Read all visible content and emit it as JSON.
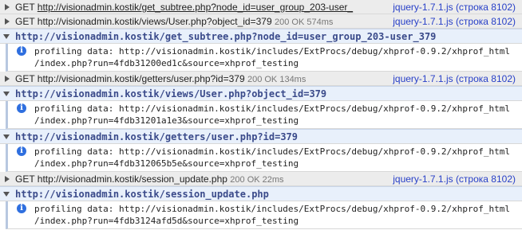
{
  "rows": [
    {
      "kind": "req",
      "method": "GET",
      "url": "http://visionadmin.kostik/get_subtree.php?node_id=user_group_203-user_",
      "status": "",
      "source": "jquery-1.7.1.js (строка 8102)"
    },
    {
      "kind": "req",
      "method": "GET",
      "url": "http://visionadmin.kostik/views/User.php?object_id=379",
      "status": "200 OK 574ms",
      "source": "jquery-1.7.1.js (строка 8102)"
    },
    {
      "kind": "grp",
      "url": "http://visionadmin.kostik/get_subtree.php?node_id=user_group_203-user_379"
    },
    {
      "kind": "msg",
      "line1": "profiling data: http://visionadmin.kostik/includes/ExtProcs/debug/xhprof-0.9.2/xhprof_html",
      "line2": "/index.php?run=4fdb31200ed1c&source=xhprof_testing"
    },
    {
      "kind": "req",
      "method": "GET",
      "url": "http://visionadmin.kostik/getters/user.php?id=379",
      "status": "200 OK 134ms",
      "source": "jquery-1.7.1.js (строка 8102)"
    },
    {
      "kind": "grp",
      "url": "http://visionadmin.kostik/views/User.php?object_id=379"
    },
    {
      "kind": "msg",
      "line1": "profiling data: http://visionadmin.kostik/includes/ExtProcs/debug/xhprof-0.9.2/xhprof_html",
      "line2": "/index.php?run=4fdb31201a1e3&source=xhprof_testing"
    },
    {
      "kind": "grp",
      "url": "http://visionadmin.kostik/getters/user.php?id=379"
    },
    {
      "kind": "msg",
      "line1": "profiling data: http://visionadmin.kostik/includes/ExtProcs/debug/xhprof-0.9.2/xhprof_html",
      "line2": "/index.php?run=4fdb312065b5e&source=xhprof_testing"
    },
    {
      "kind": "req",
      "method": "GET",
      "url": "http://visionadmin.kostik/session_update.php",
      "status": "200 OK 22ms",
      "source": "jquery-1.7.1.js (строка 8102)"
    },
    {
      "kind": "grp",
      "url": "http://visionadmin.kostik/session_update.php"
    },
    {
      "kind": "msg",
      "line1": "profiling data: http://visionadmin.kostik/includes/ExtProcs/debug/xhprof-0.9.2/xhprof_html",
      "line2": "/index.php?run=4fdb3124afd5d&source=xhprof_testing"
    }
  ]
}
